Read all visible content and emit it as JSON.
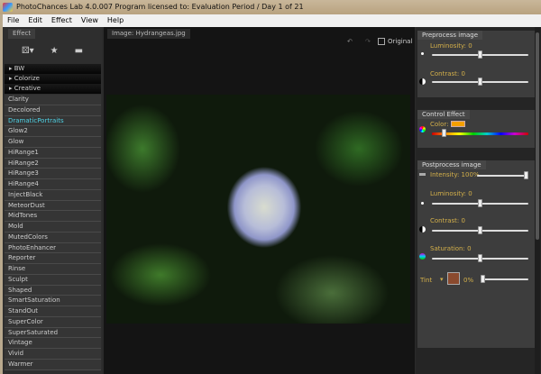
{
  "window": {
    "title": "PhotoChances Lab 4.0.007   Program licensed to: Evaluation Period / Day 1 of 21"
  },
  "menu": [
    "File",
    "Edit",
    "Effect",
    "View",
    "Help"
  ],
  "left": {
    "label": "Effect",
    "categories": [
      "BW",
      "Colorize",
      "Creative"
    ],
    "effects": [
      "Clarity",
      "Decolored",
      "DramaticPortraits",
      "Glow2",
      "Glow",
      "HiRange1",
      "HiRange2",
      "HiRange3",
      "HiRange4",
      "InjectBlack",
      "MeteorDust",
      "MidTones",
      "Mold",
      "MutedColors",
      "PhotoEnhancer",
      "Reporter",
      "Rinse",
      "Sculpt",
      "Shaped",
      "SmartSaturation",
      "StandOut",
      "SuperColor",
      "SuperSaturated",
      "Vintage",
      "Vivid",
      "Warmer"
    ],
    "selected": "DramaticPortraits"
  },
  "center": {
    "image_label": "Image: Hydrangeas.jpg",
    "original_label": "Original",
    "original_checked": false
  },
  "preprocess": {
    "label": "Preprocess image",
    "luminosity_label": "Luminosity: 0",
    "luminosity": 0,
    "contrast_label": "Contrast: 0",
    "contrast": 0
  },
  "control": {
    "label": "Control Effect",
    "color_label": "Color:",
    "color": "#f5a000",
    "hue_position": 0.1
  },
  "postprocess": {
    "label": "Postprocess image",
    "intensity_label": "Intensity: 100%",
    "intensity": 100,
    "luminosity_label": "Luminosity: 0",
    "luminosity": 0,
    "contrast_label": "Contrast: 0",
    "contrast": 0,
    "saturation_label": "Saturation: 0",
    "saturation": 0,
    "tint_label": "Tint",
    "tint_color": "#8a4a2e",
    "tint_value_label": "0%",
    "tint": 0
  },
  "colors": {
    "accent_text": "#d4b04a",
    "selected_effect": "#4fd3e6"
  }
}
